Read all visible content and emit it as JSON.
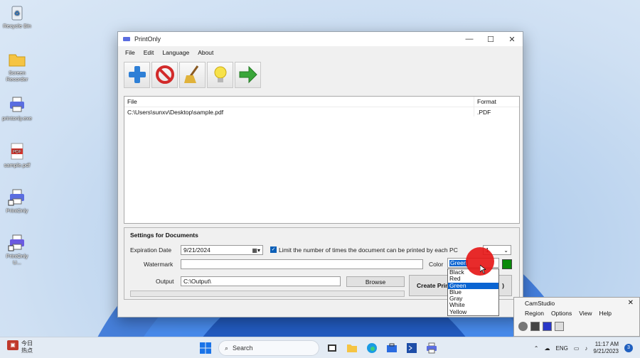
{
  "desktop": {
    "icons": [
      {
        "label": "Recycle Bin",
        "icon": "recycle-bin-icon"
      },
      {
        "label": "Screen Recorder",
        "icon": "folder-icon"
      },
      {
        "label": "printonly.exe",
        "icon": "printer-icon"
      },
      {
        "label": "sample.pdf",
        "icon": "pdf-icon"
      },
      {
        "label": "PrintOnly",
        "icon": "printer-shortcut-icon"
      },
      {
        "label": "PrintOnly U...",
        "icon": "printer-shortcut-icon"
      }
    ]
  },
  "window": {
    "title": "PrintOnly",
    "controls": {
      "minimize": "—",
      "maximize": "☐",
      "close": "✕"
    },
    "menu": [
      "File",
      "Edit",
      "Language",
      "About"
    ],
    "toolbar": [
      {
        "name": "add",
        "icon": "plus-icon"
      },
      {
        "name": "remove",
        "icon": "forbidden-icon"
      },
      {
        "name": "clear",
        "icon": "broom-icon"
      },
      {
        "name": "tips",
        "icon": "lightbulb-icon"
      },
      {
        "name": "go",
        "icon": "arrow-right-icon"
      }
    ],
    "file_list": {
      "columns": [
        "File",
        "Format"
      ],
      "rows": [
        {
          "file": "C:\\Users\\sunxv\\Desktop\\sample.pdf",
          "format": ".PDF"
        }
      ]
    },
    "settings": {
      "heading": "Settings for Documents",
      "expiration_label": "Expiration Date",
      "expiration_value": "9/21/2024",
      "limit_label": "Limit the number of times the document can be printed by each PC",
      "limit_checked": true,
      "limit_value": "1",
      "watermark_label": "Watermark",
      "watermark_value": "",
      "color_label": "Color",
      "color_value": "Green",
      "color_swatch": "#0a8a0a",
      "color_options": [
        "Black",
        "Red",
        "Green",
        "Blue",
        "Gray",
        "White",
        "Yellow"
      ],
      "output_label": "Output",
      "output_value": "C:\\Output\\",
      "browse_label": "Browse",
      "create_label": "Create Prin",
      "create_tail": ")"
    }
  },
  "camstudio": {
    "title": "CamStudio",
    "menu": [
      "Region",
      "Options",
      "View",
      "Help"
    ]
  },
  "taskbar": {
    "weather_temp": "今日",
    "weather_desc": "热点",
    "search_placeholder": "Search",
    "language": "ENG",
    "time": "11:17 AM",
    "date": "9/21/2023",
    "notification_count": "3"
  }
}
